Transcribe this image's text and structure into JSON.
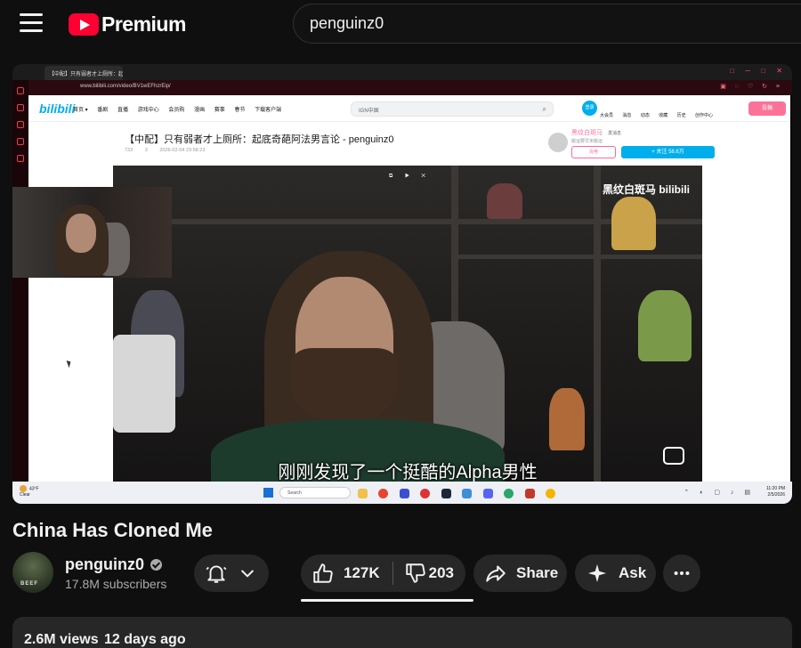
{
  "header": {
    "logo_text": "Premium",
    "search_value": "penguinz0"
  },
  "stream": {
    "browser": {
      "tab_title": "【中配】只有弱者才上厕所：起",
      "url": "www.bilibili.com/video/BV1wEFhzrEip/"
    },
    "bilibili": {
      "logo": "bilibili",
      "nav": [
        "首页 ▾",
        "番剧",
        "直播",
        "游戏中心",
        "会员购",
        "漫画",
        "赛事",
        "春节",
        "下载客户端"
      ],
      "search_placeholder": "IGN中国",
      "login_label": "登录",
      "right_nav": [
        "大会员",
        "消息",
        "动态",
        "收藏",
        "历史",
        "创作中心"
      ],
      "upload_label": "投稿",
      "video_title": "【中配】只有弱者才上厕所：起底奇葩阿法男言论 - penguinz0",
      "views": "733",
      "comments": "3",
      "date": "2026-02-04 23:58:23",
      "uploader": "黑纹白斑马",
      "message_label": "发消息",
      "uploader_desc": "搬运要早米搬运",
      "charge_label": "充电",
      "follow_label": "+ 关注 58.6万",
      "watermark": "黑纹白斑马 bilibili",
      "subtitle": "刚刚发现了一个挺酷的Alpha男性"
    },
    "taskbar": {
      "temp": "43°F",
      "weather": "Clear",
      "search_placeholder": "Search",
      "time": "11:20 PM",
      "date": "2/5/2026"
    }
  },
  "video": {
    "title": "China Has Cloned Me"
  },
  "channel": {
    "name": "penguinz0",
    "subscribers": "17.8M subscribers",
    "avatar_text": "BEEF"
  },
  "actions": {
    "likes": "127K",
    "dislikes": "203",
    "share": "Share",
    "ask": "Ask"
  },
  "description": {
    "views": "2.6M views",
    "age": "12 days ago"
  },
  "colors": {
    "brand_red": "#ff0033",
    "background": "#0f0f0f",
    "pill": "#272727",
    "bilibili_blue": "#00aeec",
    "bilibili_pink": "#fb7299"
  }
}
